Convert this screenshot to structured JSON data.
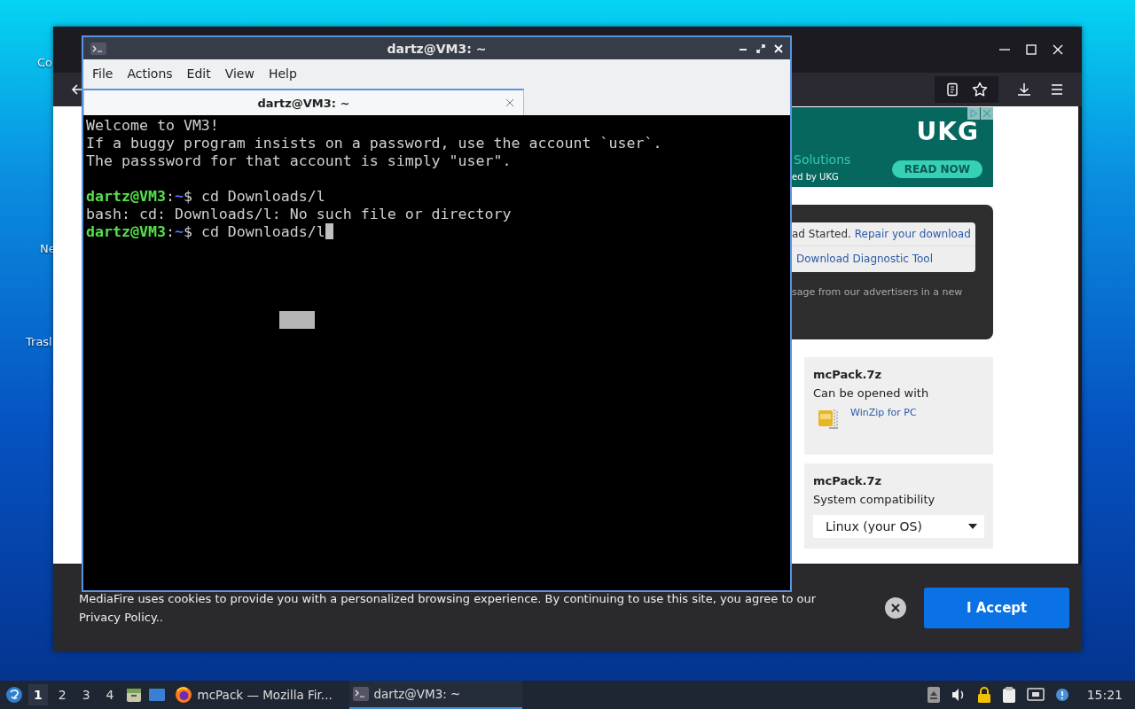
{
  "desktop": {
    "icons": [
      {
        "label": "Co"
      },
      {
        "label": "Ne"
      },
      {
        "label": "Trasl"
      }
    ]
  },
  "browser": {
    "ad": {
      "logo": "UKG",
      "text_1": "Solutions",
      "text_2": "ed by UKG",
      "button": "READ NOW"
    },
    "notice": {
      "text": "ad Started.",
      "link_1": "Repair your download",
      "link_2": "Download Diagnostic Tool",
      "footer": "sage from our advertisers in a new"
    },
    "cards": [
      {
        "kind": "app",
        "title": "mcPack.7z",
        "subtitle": "Can be opened with",
        "link": "WinZip for PC"
      },
      {
        "kind": "os",
        "title": "mcPack.7z",
        "subtitle": "System compatibility",
        "select": "Linux (your OS)"
      }
    ],
    "cookie_bar": {
      "text": "MediaFire uses cookies to provide you with a personalized browsing experience. By continuing to use this site, you agree to our Privacy Policy..",
      "button": "I Accept"
    }
  },
  "terminal": {
    "title": "dartz@VM3: ~",
    "menu": [
      "File",
      "Actions",
      "Edit",
      "View",
      "Help"
    ],
    "tabs": [
      {
        "label": "dartz@VM3: ~",
        "selected": true
      }
    ],
    "lines": [
      {
        "kind": "text",
        "text": "Welcome to VM3!"
      },
      {
        "kind": "text",
        "text": "If a buggy program insists on a password, use the account `user`."
      },
      {
        "kind": "text",
        "text": "The passsword for that account is simply \"user\"."
      },
      {
        "kind": "blank"
      },
      {
        "kind": "prompt",
        "user": "dartz@VM3",
        "separator": ":",
        "path": "~",
        "command": "$ cd Downloads/l",
        "cursor": false
      },
      {
        "kind": "text",
        "text": "bash: cd: Downloads/l: No such file or directory"
      },
      {
        "kind": "prompt",
        "user": "dartz@VM3",
        "separator": ":",
        "path": "~",
        "command": "$ cd Downloads/l",
        "cursor": true
      }
    ]
  },
  "taskbar": {
    "workspaces": [
      {
        "label": "1",
        "selected": true
      },
      {
        "label": "2",
        "selected": false
      },
      {
        "label": "3",
        "selected": false
      },
      {
        "label": "4",
        "selected": false
      }
    ],
    "tasks": [
      {
        "kind": "browser",
        "label": "mcPack — Mozilla Fir...",
        "selected": false
      },
      {
        "kind": "terminal",
        "label": "dartz@VM3: ~",
        "selected": true
      }
    ],
    "clock": "15:21"
  }
}
